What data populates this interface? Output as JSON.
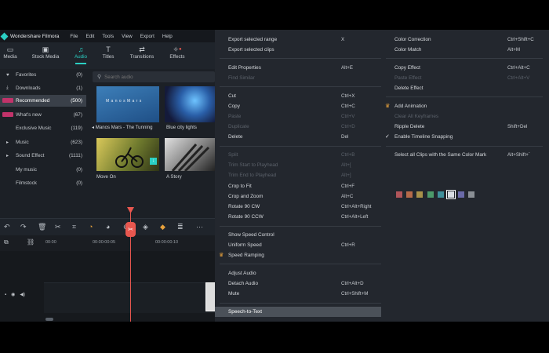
{
  "app": {
    "title": "Wondershare Filmora",
    "menu": [
      "File",
      "Edit",
      "Tools",
      "View",
      "Export",
      "Help"
    ]
  },
  "toolbar": {
    "tabs": [
      {
        "label": "Media",
        "icon": "folder-icon"
      },
      {
        "label": "Stock Media",
        "icon": "stock-media-icon"
      },
      {
        "label": "Audio",
        "icon": "music-note-icon",
        "active": true
      },
      {
        "label": "Titles",
        "icon": "text-t-icon"
      },
      {
        "label": "Transitions",
        "icon": "transitions-icon"
      },
      {
        "label": "Effects",
        "icon": "effects-icon"
      }
    ]
  },
  "sidebar": {
    "items": [
      {
        "label": "Favorites",
        "count": "(0)"
      },
      {
        "label": "Downloads",
        "count": "(1)"
      },
      {
        "label": "Recommended",
        "count": "(500)",
        "selected": true
      },
      {
        "label": "What's new",
        "count": "(67)"
      },
      {
        "label": "Exclusive Music",
        "count": "(119)"
      },
      {
        "label": "Music",
        "count": "(623)"
      },
      {
        "label": "Sound Effect",
        "count": "(1111)"
      },
      {
        "label": "My music",
        "count": "(0)"
      },
      {
        "label": "Filmstock",
        "count": "(0)"
      }
    ]
  },
  "media": {
    "search_placeholder": "Search audio",
    "thumbnails": [
      {
        "caption": "Manos Mars - The Tunning",
        "overlay": "M a n o s  M a r s"
      },
      {
        "caption": "Blue city lights"
      },
      {
        "caption": "Move On"
      },
      {
        "caption": "A Story"
      }
    ]
  },
  "timeline": {
    "timecodes": [
      "00:00",
      "00:00:00:05",
      "00:00:00:10"
    ]
  },
  "context_menu": {
    "left": [
      {
        "label": "Export selected range",
        "shortcut": "X"
      },
      {
        "label": "Export selected clips",
        "shortcut": ""
      },
      {
        "label": "Edit Properties",
        "shortcut": "Alt+E"
      },
      {
        "label": "Find Similar",
        "shortcut": "",
        "disabled": true
      },
      {
        "label": "Cut",
        "shortcut": "Ctrl+X"
      },
      {
        "label": "Copy",
        "shortcut": "Ctrl+C"
      },
      {
        "label": "Paste",
        "shortcut": "Ctrl+V",
        "disabled": true
      },
      {
        "label": "Duplicate",
        "shortcut": "Ctrl+D",
        "disabled": true
      },
      {
        "label": "Delete",
        "shortcut": "Del"
      },
      {
        "label": "Split",
        "shortcut": "Ctrl+B",
        "disabled": true
      },
      {
        "label": "Trim Start to Playhead",
        "shortcut": "Alt+[",
        "disabled": true
      },
      {
        "label": "Trim End to Playhead",
        "shortcut": "Alt+]",
        "disabled": true
      },
      {
        "label": "Crop to Fit",
        "shortcut": "Ctrl+F"
      },
      {
        "label": "Crop and Zoom",
        "shortcut": "Alt+C"
      },
      {
        "label": "Rotate 90 CW",
        "shortcut": "Ctrl+Alt+Right"
      },
      {
        "label": "Rotate 90 CCW",
        "shortcut": "Ctrl+Alt+Left"
      },
      {
        "label": "Show Speed Control",
        "shortcut": ""
      },
      {
        "label": "Uniform Speed",
        "shortcut": "Ctrl+R"
      },
      {
        "label": "Speed Ramping",
        "shortcut": "",
        "crown": true
      },
      {
        "label": "Adjust Audio",
        "shortcut": ""
      },
      {
        "label": "Detach Audio",
        "shortcut": "Ctrl+Alt+D"
      },
      {
        "label": "Mute",
        "shortcut": "Ctrl+Shift+M"
      },
      {
        "label": "Speech-to-Text",
        "shortcut": "",
        "highlighted": true
      }
    ],
    "right": [
      {
        "label": "Color Correction",
        "shortcut": "Ctrl+Shift+C"
      },
      {
        "label": "Color Match",
        "shortcut": "Alt+M"
      },
      {
        "label": "Copy Effect",
        "shortcut": "Ctrl+Alt+C"
      },
      {
        "label": "Paste Effect",
        "shortcut": "Ctrl+Alt+V",
        "disabled": true
      },
      {
        "label": "Delete Effect",
        "shortcut": ""
      },
      {
        "label": "Add Animation",
        "shortcut": "",
        "crown": true
      },
      {
        "label": "Clear All Keyframes",
        "shortcut": "",
        "disabled": true
      },
      {
        "label": "Ripple Delete",
        "shortcut": "Shift+Del"
      },
      {
        "label": "Enable Timeline Snapping",
        "shortcut": "",
        "checked": true
      },
      {
        "label": "Select all Clips with the Same Color Mark",
        "shortcut": "Alt+Shift+`"
      }
    ],
    "color_marks": [
      "#b0555a",
      "#b56a4a",
      "#a8914a",
      "#4c9a6a",
      "#3f8f9a",
      "#d9dde2",
      "#6a6aa8",
      "#8a8f95"
    ]
  },
  "colors": {
    "accent": "#2bd0c4",
    "playhead": "#e8574f",
    "crown": "#e8a23c"
  }
}
